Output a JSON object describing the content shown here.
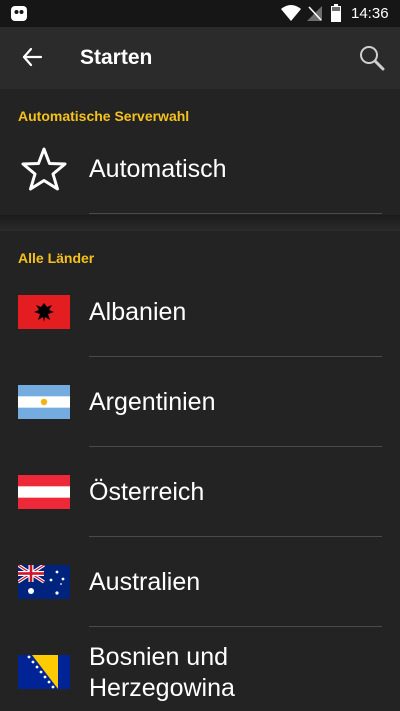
{
  "status_bar": {
    "time": "14:36",
    "icons": [
      "ghost-app-icon",
      "wifi-icon",
      "no-sim-icon",
      "battery-icon"
    ]
  },
  "toolbar": {
    "title": "Starten",
    "back_icon": "arrow-left-icon",
    "search_icon": "search-icon"
  },
  "sections": {
    "auto": {
      "header": "Automatische Serverwahl",
      "item": {
        "label": "Automatisch",
        "icon": "star-outline-icon"
      }
    },
    "all": {
      "header": "Alle Länder",
      "items": [
        {
          "label": "Albanien",
          "flag": "albania-flag-icon"
        },
        {
          "label": "Argentinien",
          "flag": "argentina-flag-icon"
        },
        {
          "label": "Österreich",
          "flag": "austria-flag-icon"
        },
        {
          "label": "Australien",
          "flag": "australia-flag-icon"
        },
        {
          "label": "Bosnien und Herzegowina",
          "flag": "bosnia-flag-icon"
        }
      ]
    }
  },
  "colors": {
    "accent": "#f5c21b",
    "background": "#232323",
    "toolbar": "#2b2b2b",
    "statusbar": "#161616",
    "separator": "#4a4a4a"
  }
}
